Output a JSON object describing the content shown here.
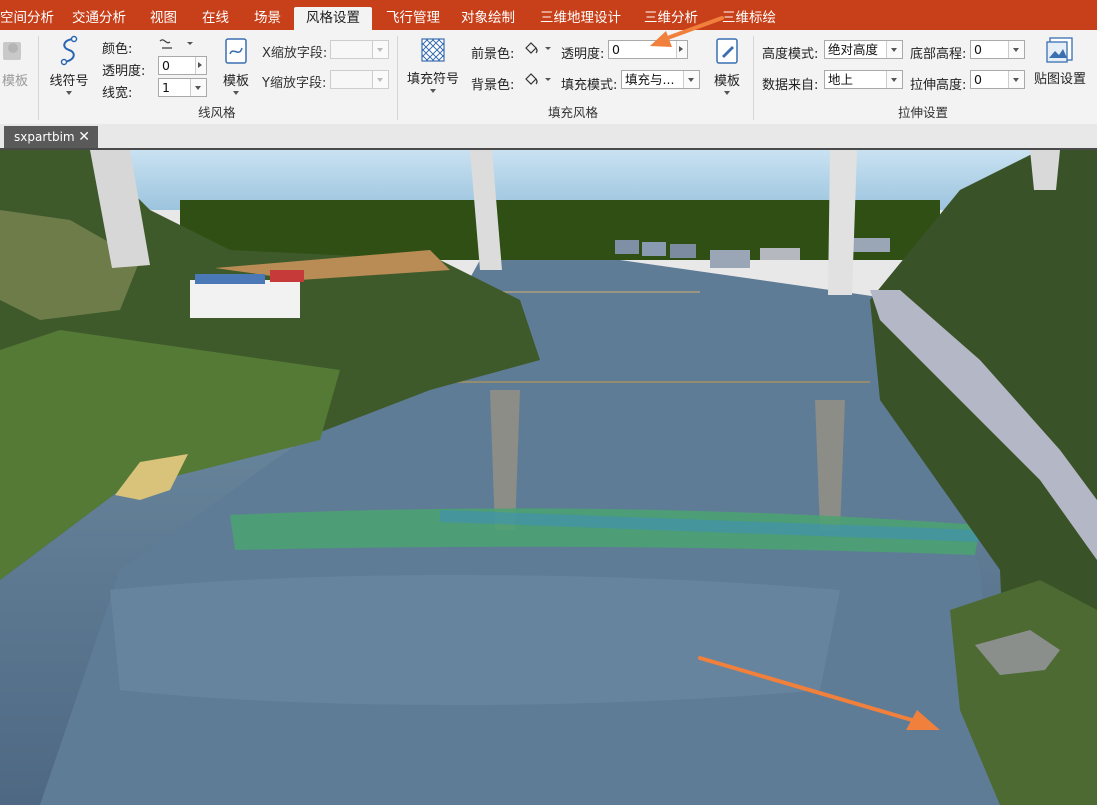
{
  "menu": {
    "tabs": [
      {
        "label": "空间分析",
        "display": "空间分析"
      },
      {
        "label": "交通分析"
      },
      {
        "label": "视图"
      },
      {
        "label": "在线"
      },
      {
        "label": "场景"
      },
      {
        "label": "风格设置",
        "active": true
      },
      {
        "label": "飞行管理"
      },
      {
        "label": "对象绘制"
      },
      {
        "label": "三维地理设计"
      },
      {
        "label": "三维分析"
      },
      {
        "label": "三维标绘"
      }
    ],
    "visible_first_tab_text": "空间分析"
  },
  "ribbon": {
    "left_template": {
      "label": "模板"
    },
    "line_style": {
      "symbol_label": "线符号",
      "color_label": "颜色:",
      "opacity_label": "透明度:",
      "opacity_value": "0",
      "width_label": "线宽:",
      "width_value": "1",
      "template_label": "模板",
      "x_scale_label": "X缩放字段:",
      "y_scale_label": "Y缩放字段:",
      "x_scale_value": "",
      "y_scale_value": "",
      "group_label": "线风格"
    },
    "fill_style": {
      "fill_symbol_label": "填充符号",
      "foreground_label": "前景色:",
      "background_label": "背景色:",
      "opacity_label": "透明度:",
      "opacity_value": "0",
      "fill_mode_label": "填充模式:",
      "fill_mode_value": "填充与...",
      "template_label": "模板",
      "group_label": "填充风格"
    },
    "extrude": {
      "height_mode_label": "高度模式:",
      "height_mode_value": "绝对高度",
      "bottom_alt_label": "底部高程:",
      "bottom_alt_value": "0",
      "data_from_label": "数据来自:",
      "data_from_value": "地上",
      "extrude_height_label": "拉伸高度:",
      "extrude_height_value": "0",
      "texture_label": "贴图设置",
      "group_label": "拉伸设置"
    }
  },
  "document": {
    "tab_label": "sxpartbim",
    "close_glyph": "✕"
  },
  "annotations": {
    "arrow_color": "#f0803c"
  },
  "colors": {
    "menu_bar": "#c8401a",
    "ribbon_bg": "#f3f3f3",
    "water": "#56708c",
    "vegetation": "#3e5a2a",
    "sky": "#bcd7ea"
  }
}
